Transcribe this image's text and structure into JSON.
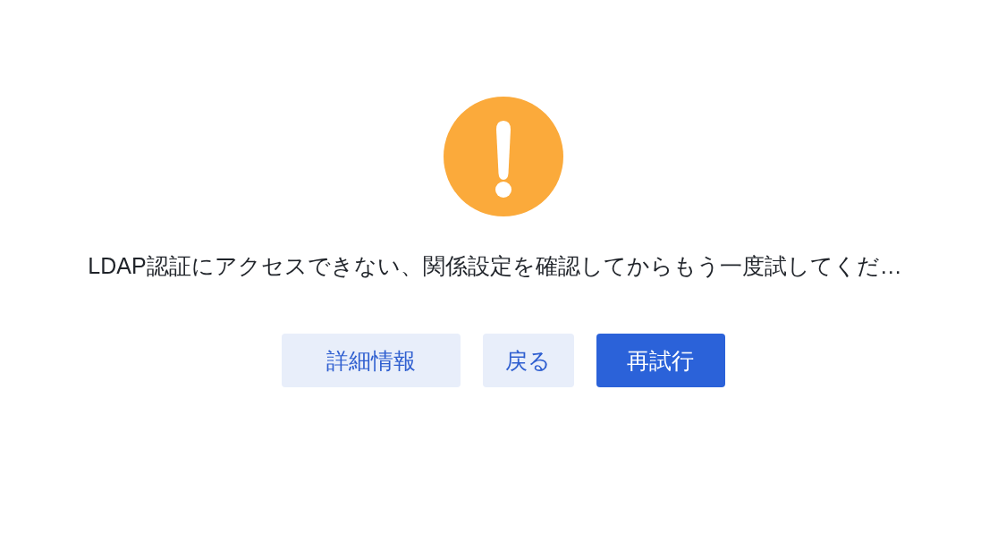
{
  "alert": {
    "message": "LDAP認証にアクセスできない、関係設定を確認してからもう一度試してくだ…"
  },
  "buttons": [
    {
      "label": "詳細情報",
      "kind": "secondary"
    },
    {
      "label": "戻る",
      "kind": "secondary"
    },
    {
      "label": "再試行",
      "kind": "primary"
    }
  ]
}
